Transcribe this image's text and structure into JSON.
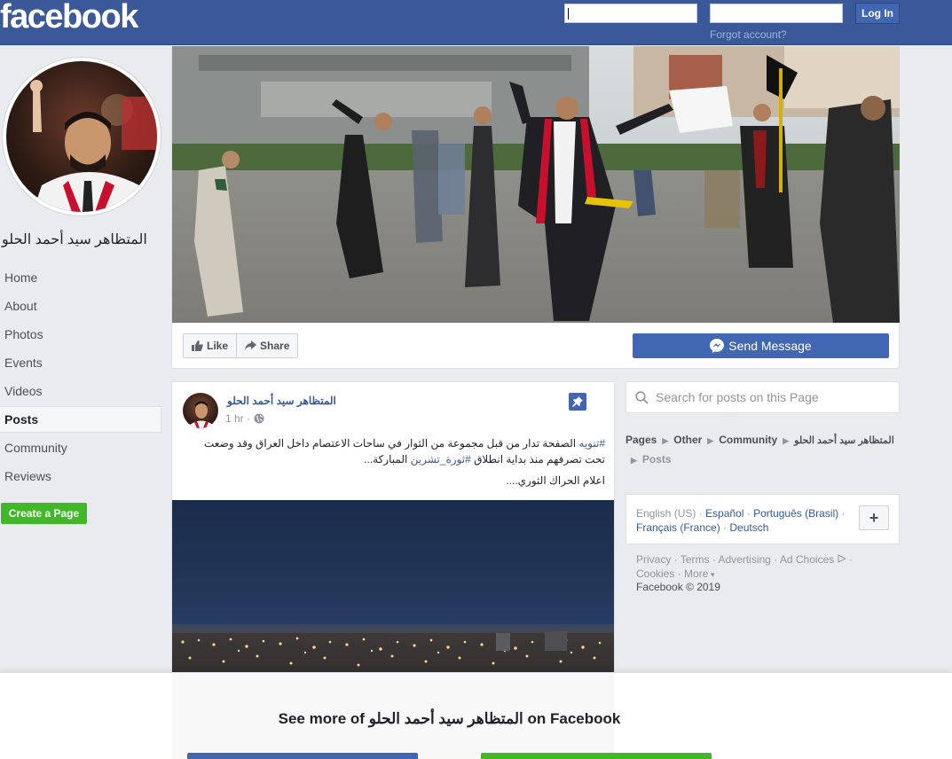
{
  "header": {
    "logo": "facebook",
    "email_placeholder": "",
    "password_placeholder": "",
    "login_label": "Log In",
    "forgot_label": "Forgot account?"
  },
  "page": {
    "name": "المتظاهر سيد أحمد الحلو"
  },
  "sidebar": {
    "items": [
      {
        "label": "Home"
      },
      {
        "label": "About"
      },
      {
        "label": "Photos"
      },
      {
        "label": "Events"
      },
      {
        "label": "Videos"
      },
      {
        "label": "Posts"
      },
      {
        "label": "Community"
      },
      {
        "label": "Reviews"
      }
    ],
    "create_page_label": "Create a Page"
  },
  "cover": {
    "like_label": "Like",
    "share_label": "Share",
    "send_message_label": "Send Message"
  },
  "post": {
    "author": "المتظاهر سيد أحمد الحلو",
    "time": "1 hr ·",
    "text_hashtag1": "#تنويه",
    "text_body": " الصفحة تدار من قبل مجموعة من الثوار في ساحات الاعتصام داخل العراق وقد وضعت تحت تصرفهم منذ بداية انطلاق ",
    "text_hashtag2": "#ثورة_تشرين",
    "text_end": " المباركة...",
    "text_line2": "اعلام الحراك الثوري...."
  },
  "search": {
    "placeholder": "Search for posts on this Page"
  },
  "breadcrumb": {
    "pages": "Pages",
    "other": "Other",
    "community": "Community",
    "page_name": "المتظاهر سيد أحمد الحلو",
    "posts": "Posts"
  },
  "languages": {
    "current": "English (US)",
    "espanol": "Español",
    "portugues": "Português (Brasil)",
    "francais": "Français (France)",
    "deutsch": "Deutsch",
    "plus": "+"
  },
  "footer": {
    "privacy": "Privacy",
    "terms": "Terms",
    "advertising": "Advertising",
    "ad_choices": "Ad Choices",
    "cookies": "Cookies",
    "more": "More",
    "copyright": "Facebook © 2019"
  },
  "overlay": {
    "prefix": "See more of ",
    "name": "المتظاهر سيد أحمد الحلو",
    "suffix": " on Facebook"
  },
  "colors": {
    "brand_blue": "#3b5998",
    "button_blue": "#4267b2",
    "create_green": "#42b72a",
    "link_blue": "#365899"
  }
}
